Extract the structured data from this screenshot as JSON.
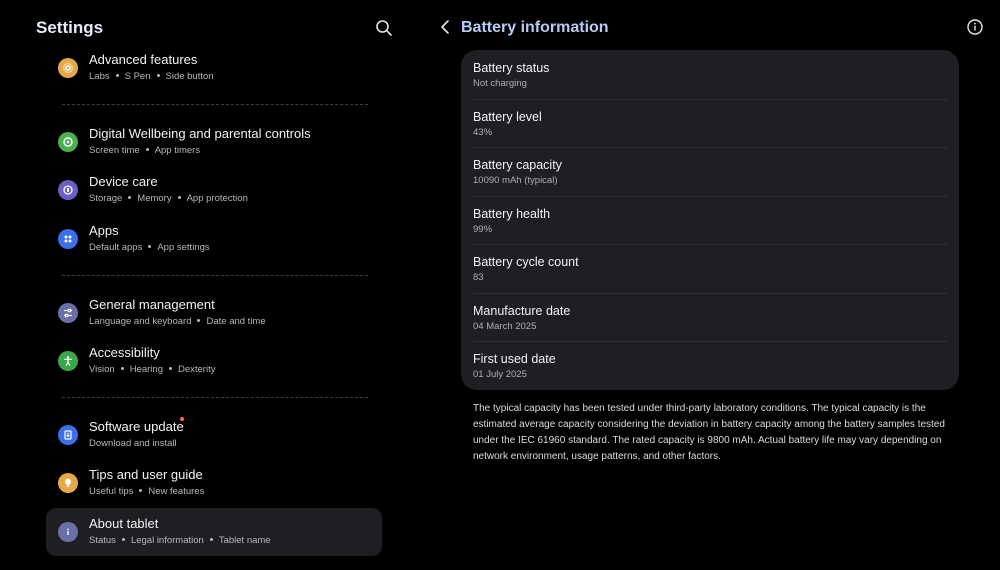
{
  "left": {
    "title": "Settings",
    "search_icon": "search-icon",
    "items": [
      {
        "title": "Advanced features",
        "subs": [
          "Labs",
          "S Pen",
          "Side button"
        ],
        "icon": "gear-icon",
        "color": "#e5a94a"
      },
      {
        "title": "Digital Wellbeing and parental controls",
        "subs": [
          "Screen time",
          "App timers"
        ],
        "icon": "wellbeing-icon",
        "color": "#4caf50"
      },
      {
        "title": "Device care",
        "subs": [
          "Storage",
          "Memory",
          "App protection"
        ],
        "icon": "device-care-icon",
        "color": "#6a5fc4"
      },
      {
        "title": "Apps",
        "subs": [
          "Default apps",
          "App settings"
        ],
        "icon": "apps-icon",
        "color": "#3d6fe8"
      },
      {
        "title": "General management",
        "subs": [
          "Language and keyboard",
          "Date and time"
        ],
        "icon": "sliders-icon",
        "color": "#6a6fa8"
      },
      {
        "title": "Accessibility",
        "subs": [
          "Vision",
          "Hearing",
          "Dexterity"
        ],
        "icon": "accessibility-icon",
        "color": "#3aa84a"
      },
      {
        "title": "Software update",
        "subs": [
          "Download and install"
        ],
        "icon": "software-update-icon",
        "color": "#3d6fe8"
      },
      {
        "title": "Tips and user guide",
        "subs": [
          "Useful tips",
          "New features"
        ],
        "icon": "lightbulb-icon",
        "color": "#e5a94a"
      },
      {
        "title": "About tablet",
        "subs": [
          "Status",
          "Legal information",
          "Tablet name"
        ],
        "icon": "info-icon",
        "color": "#6a6fa8"
      }
    ]
  },
  "right": {
    "title": "Battery information",
    "back_icon": "back-arrow-icon",
    "info_icon": "info-circle-icon",
    "rows": [
      {
        "title": "Battery status",
        "value": "Not charging"
      },
      {
        "title": "Battery level",
        "value": "43%"
      },
      {
        "title": "Battery capacity",
        "value": "10090 mAh (typical)"
      },
      {
        "title": "Battery health",
        "value": "99%"
      },
      {
        "title": "Battery cycle count",
        "value": "83"
      },
      {
        "title": "Manufacture date",
        "value": "04 March 2025"
      },
      {
        "title": "First used date",
        "value": "01 July 2025"
      }
    ],
    "note": "The typical capacity has been tested under third-party laboratory conditions. The typical capacity is the estimated average capacity considering the deviation in battery capacity among the battery samples tested under the IEC 61960 standard. The rated capacity is 9800 mAh. Actual battery life may vary depending on network environment, usage patterns, and other factors."
  },
  "colors": {
    "background": "#000000",
    "card": "#1f1f23",
    "right_title": "#b7cbf4",
    "badge": "#ff6a4d"
  }
}
